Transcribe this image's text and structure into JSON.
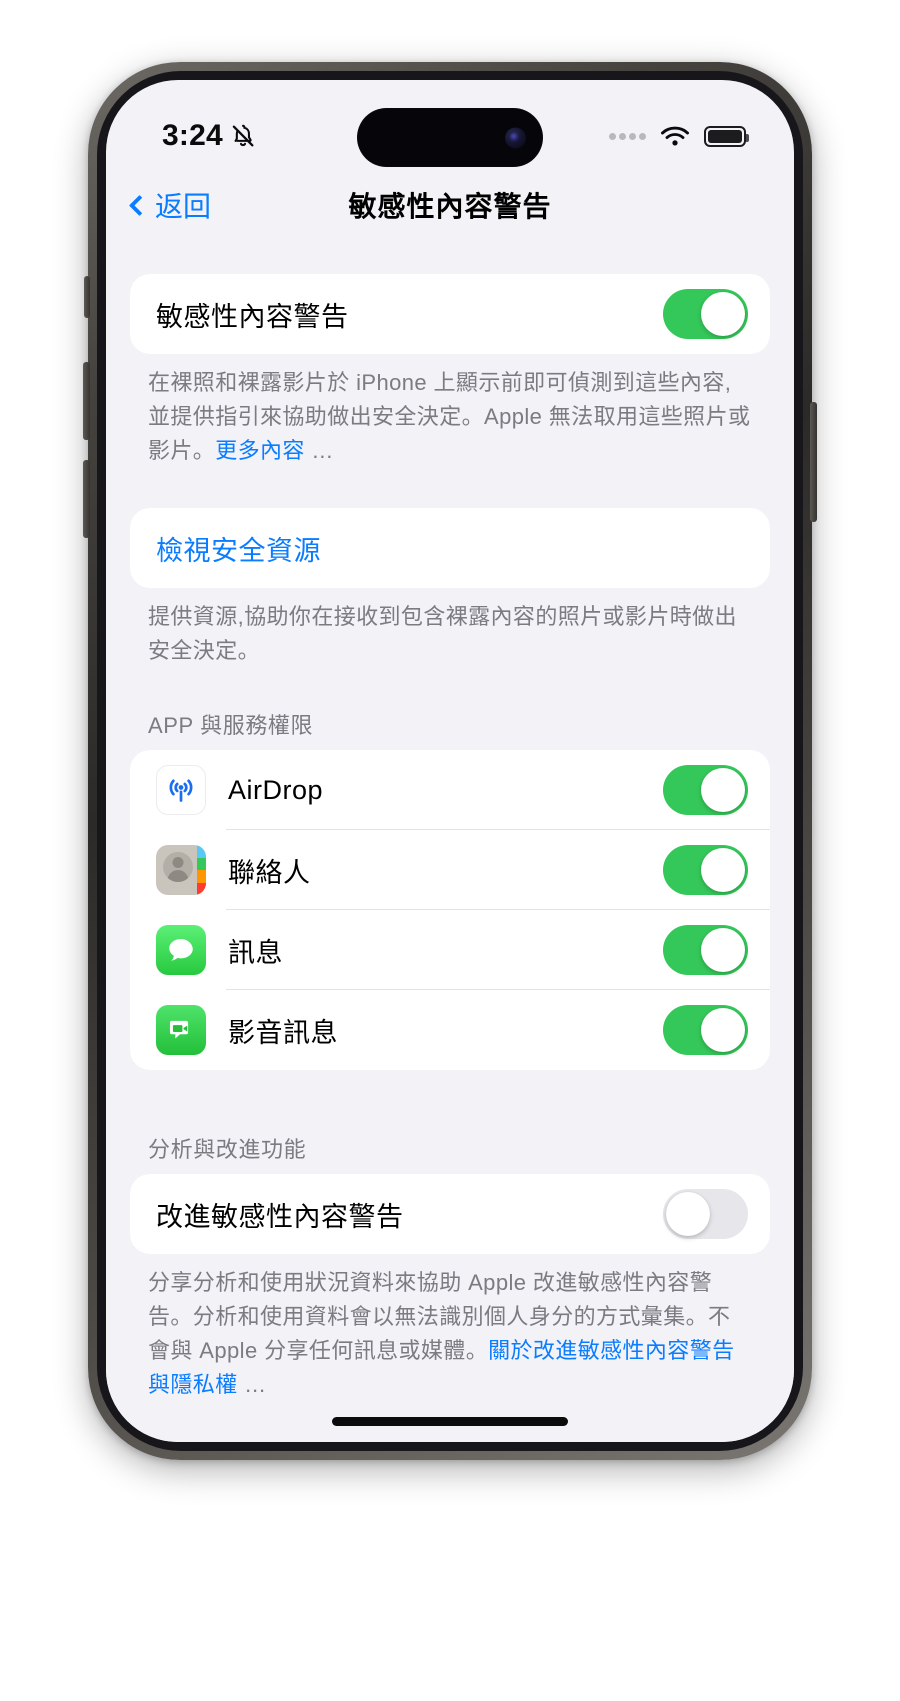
{
  "status_bar": {
    "time": "3:24",
    "bell_icon": "bell-slash-icon",
    "wifi_icon": "wifi-icon",
    "battery_icon": "battery-icon",
    "signal_icon": "signal-dots-icon"
  },
  "nav": {
    "back_label": "返回",
    "back_icon": "chevron-left-icon",
    "title": "敏感性內容警告"
  },
  "sections": {
    "main_toggle": {
      "label": "敏感性內容警告",
      "value": "on",
      "footer_text": "在裸照和裸露影片於 iPhone 上顯示前即可偵測到這些內容,並提供指引來協助做出安全決定。Apple 無法取用這些照片或影片。",
      "footer_link": "更多內容",
      "footer_ellipsis": " …"
    },
    "safety_resources": {
      "label": "檢視安全資源",
      "footer_text": "提供資源,協助你在接收到包含裸露內容的照片或影片時做出安全決定。"
    },
    "app_permissions": {
      "header": "APP 與服務權限",
      "items": [
        {
          "label": "AirDrop",
          "icon": "airdrop-icon",
          "value": "on"
        },
        {
          "label": "聯絡人",
          "icon": "contacts-icon",
          "value": "on"
        },
        {
          "label": "訊息",
          "icon": "messages-icon",
          "value": "on"
        },
        {
          "label": "影音訊息",
          "icon": "audio-message-icon",
          "value": "on"
        }
      ]
    },
    "analytics": {
      "header": "分析與改進功能",
      "label": "改進敏感性內容警告",
      "value": "off",
      "footer_text": "分享分析和使用狀況資料來協助 Apple 改進敏感性內容警告。分析和使用資料會以無法識別個人身分的方式彙集。不會與 Apple 分享任何訊息或媒體。",
      "footer_link": "關於改進敏感性內容警告與隱私權",
      "footer_ellipsis": " …"
    }
  },
  "colors": {
    "accent_blue": "#0a7cff",
    "toggle_on_green": "#34c759",
    "toggle_off_gray": "#e6e6eb",
    "background": "#f2f2f7",
    "card": "#ffffff",
    "secondary_text": "#7b7b82"
  }
}
